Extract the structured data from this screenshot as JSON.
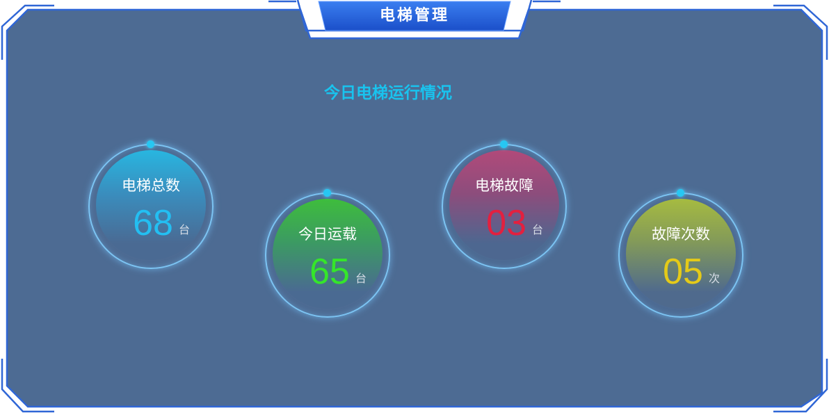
{
  "header": {
    "title": "电梯管理"
  },
  "section": {
    "title": "今日电梯运行情况"
  },
  "stats": [
    {
      "label": "电梯总数",
      "value": "68",
      "unit": "台"
    },
    {
      "label": "今日运载",
      "value": "65",
      "unit": "台"
    },
    {
      "label": "电梯故障",
      "value": "03",
      "unit": "台"
    },
    {
      "label": "故障次数",
      "value": "05",
      "unit": "次"
    }
  ],
  "colors": {
    "panel_background": "#4d6b93",
    "frame_border": "#2f66d6",
    "header_badge": "#1f55d4",
    "section_title": "#19c3ee",
    "total_value": "#23bff2",
    "running_value": "#35e62a",
    "fault_value": "#e3203f",
    "fault_count_value": "#e5ca18"
  }
}
